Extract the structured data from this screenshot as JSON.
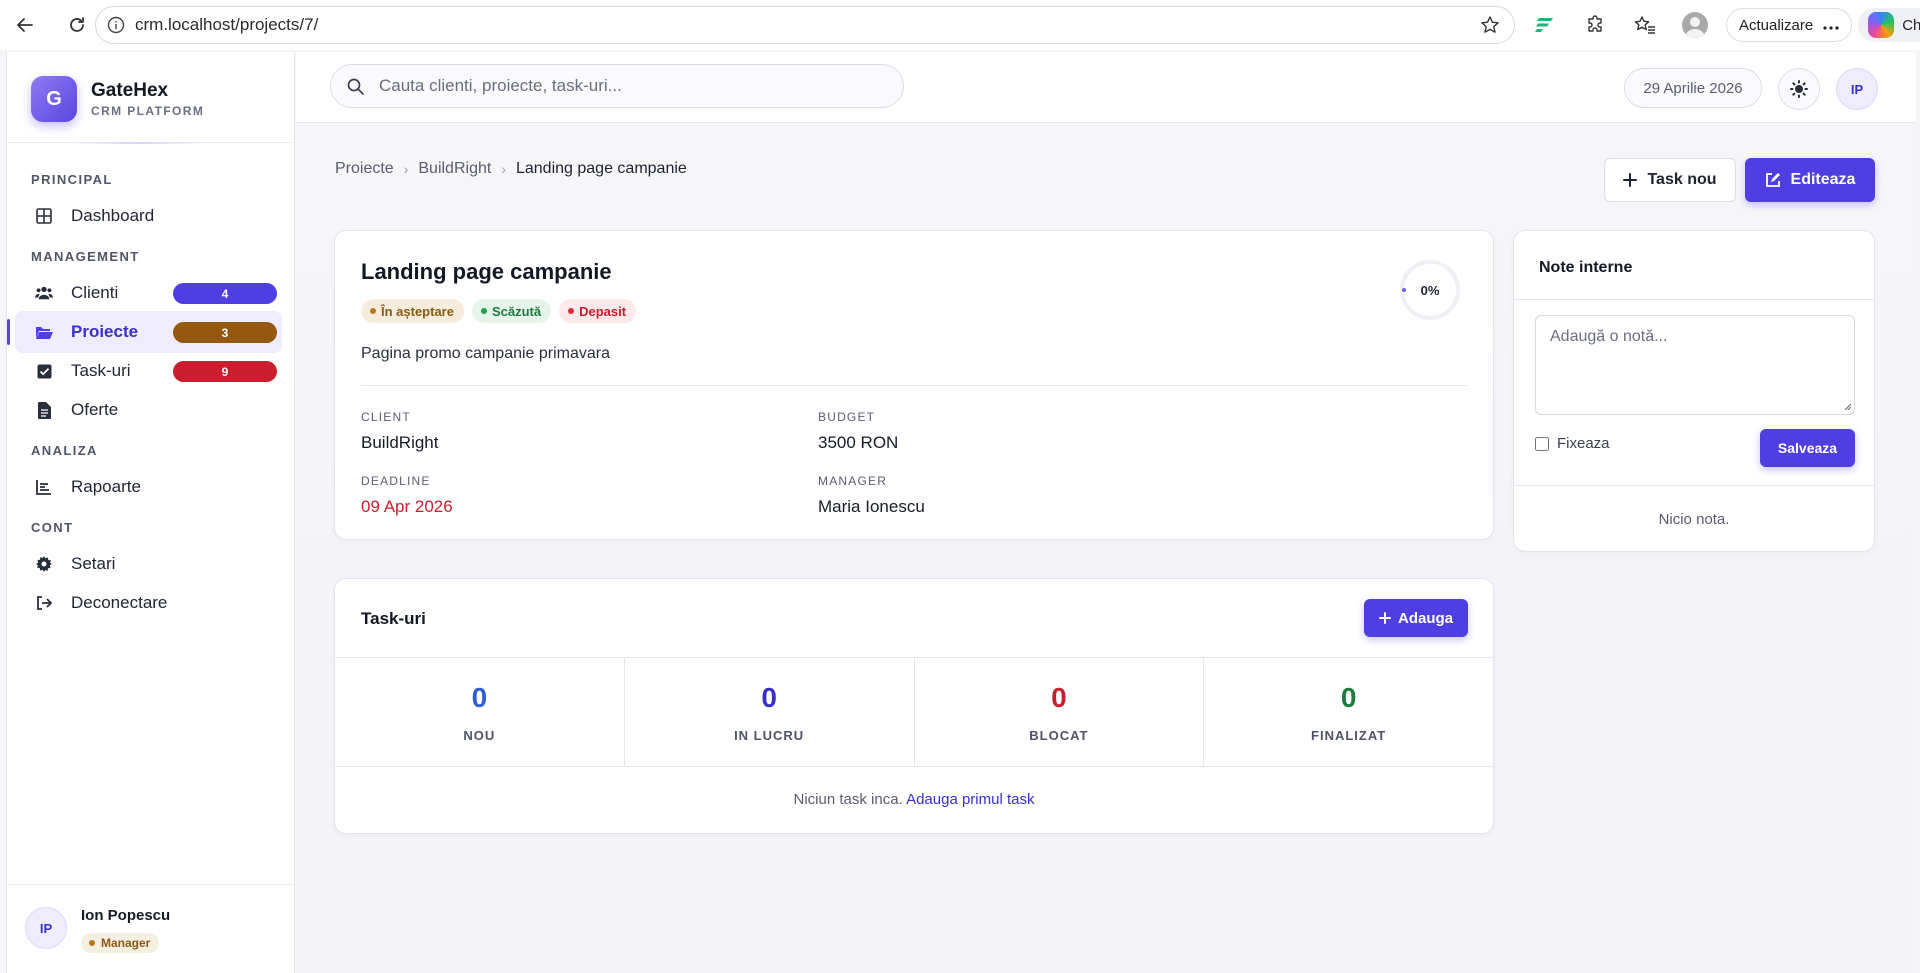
{
  "browser": {
    "url": "crm.localhost/projects/7/",
    "update_label": "Actualizare",
    "chat_label": "Chat"
  },
  "brand": {
    "logo_letter": "G",
    "name": "GateHex",
    "subtitle": "CRM PLATFORM"
  },
  "sidebar": {
    "sections": [
      {
        "title": "PRINCIPAL",
        "items": [
          {
            "label": "Dashboard",
            "icon": "grid-icon"
          }
        ]
      },
      {
        "title": "MANAGEMENT",
        "items": [
          {
            "label": "Clienti",
            "icon": "users-icon",
            "badge": "4",
            "badge_color": "#4f3ee0"
          },
          {
            "label": "Proiecte",
            "icon": "folder-open-icon",
            "badge": "3",
            "badge_color": "#96580f",
            "active": true
          },
          {
            "label": "Task-uri",
            "icon": "checkbox-icon",
            "badge": "9",
            "badge_color": "#c81e2e"
          },
          {
            "label": "Oferte",
            "icon": "document-icon"
          }
        ]
      },
      {
        "title": "ANALIZA",
        "items": [
          {
            "label": "Rapoarte",
            "icon": "chart-icon"
          }
        ]
      },
      {
        "title": "CONT",
        "items": [
          {
            "label": "Setari",
            "icon": "gear-icon"
          },
          {
            "label": "Deconectare",
            "icon": "logout-icon"
          }
        ]
      }
    ],
    "user": {
      "initials": "IP",
      "name": "Ion Popescu",
      "role": "Manager"
    }
  },
  "topbar": {
    "search_placeholder": "Cauta clienti, proiecte, task-uri...",
    "date": "29 Aprilie 2026",
    "avatar_initials": "IP"
  },
  "breadcrumb": [
    "Proiecte",
    "BuildRight",
    "Landing page campanie"
  ],
  "actions": {
    "new_task": "Task nou",
    "edit": "Editeaza"
  },
  "project": {
    "title": "Landing page campanie",
    "tags": [
      {
        "label": "În așteptare",
        "bg": "#f6ecdc",
        "fg": "#8a5a12",
        "dot": "#b7791f"
      },
      {
        "label": "Scăzută",
        "bg": "#e6f5ea",
        "fg": "#1e7a3a",
        "dot": "#22a04b"
      },
      {
        "label": "Depasit",
        "bg": "#fde8ea",
        "fg": "#c81e2e",
        "dot": "#d92b3a"
      }
    ],
    "progress": "0%",
    "description": "Pagina promo campanie primavara",
    "client_label": "CLIENT",
    "client": "BuildRight",
    "budget_label": "BUDGET",
    "budget": "3500 RON",
    "deadline_label": "DEADLINE",
    "deadline": "09 Apr 2026",
    "manager_label": "MANAGER",
    "manager": "Maria Ionescu"
  },
  "tasks": {
    "title": "Task-uri",
    "add_label": "Adauga",
    "stats": [
      {
        "value": "0",
        "label": "NOU",
        "color": "#2f5fd0"
      },
      {
        "value": "0",
        "label": "IN LUCRU",
        "color": "#3b2fc9"
      },
      {
        "value": "0",
        "label": "BLOCAT",
        "color": "#c81e2e"
      },
      {
        "value": "0",
        "label": "FINALIZAT",
        "color": "#1e7a3a"
      }
    ],
    "empty_text": "Niciun task inca.",
    "empty_link": "Adauga primul task"
  },
  "notes": {
    "title": "Note interne",
    "placeholder": "Adaugă o notă...",
    "pin_label": "Fixeaza",
    "save_label": "Salveaza",
    "empty_text": "Nicio nota."
  }
}
